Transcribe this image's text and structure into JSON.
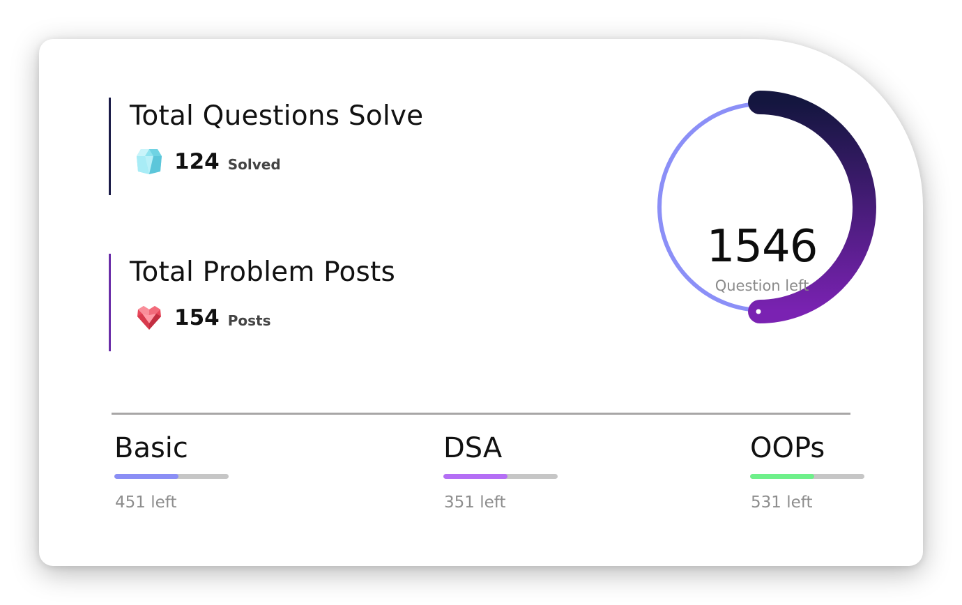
{
  "stats": {
    "solve": {
      "title": "Total Questions Solve",
      "icon": "diamond-icon",
      "value": "124",
      "unit": "Solved",
      "accent": "#1b1c48"
    },
    "posts": {
      "title": "Total Problem Posts",
      "icon": "heart-gem-icon",
      "value": "154",
      "unit": "Posts",
      "accent": "#6a2da8"
    }
  },
  "ring": {
    "value": "1546",
    "label": "Question left",
    "track_color": "#8b8ff7",
    "gradient_start": "#14163f",
    "gradient_end": "#7a22b2"
  },
  "categories": [
    {
      "name": "Basic",
      "left_text": "451 left",
      "progress": 0.56,
      "color": "#8a8ef5"
    },
    {
      "name": "DSA",
      "left_text": "351 left",
      "progress": 0.56,
      "color": "#b46ef5"
    },
    {
      "name": "OOPs",
      "left_text": "531 left",
      "progress": 0.56,
      "color": "#6ef08a"
    }
  ]
}
